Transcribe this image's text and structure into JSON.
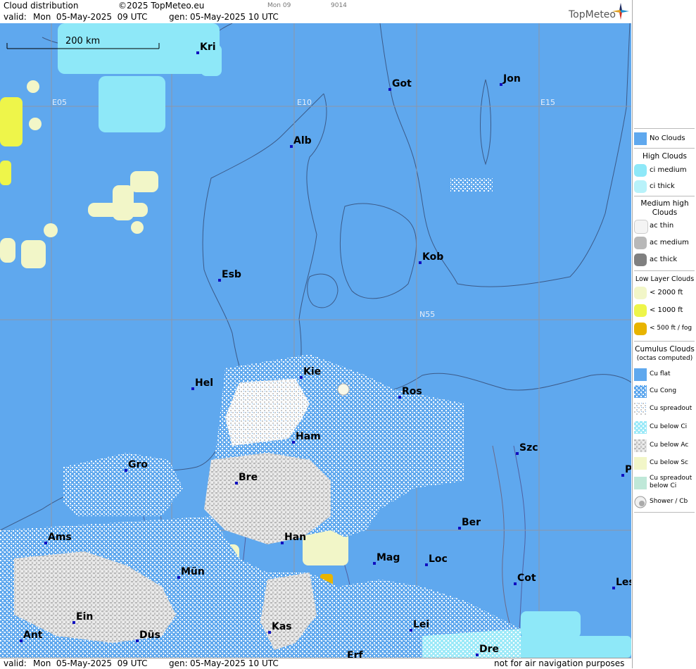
{
  "header": {
    "title": "Cloud distribution",
    "copyright": "©2025 TopMeteo.eu",
    "small_day": "Mon 09",
    "small_code": "9014",
    "valid_label": "valid:",
    "valid_value": "Mon  05-May-2025  09 UTC",
    "gen_label": "gen:",
    "gen_value": "05-May-2025 10 UTC",
    "brand": "TopMeteo"
  },
  "scale": {
    "label": "200 km"
  },
  "grid_labels": {
    "e05": "E05",
    "e10": "E10",
    "e15": "E15",
    "n55": "N55"
  },
  "cities": [
    {
      "name": "Kri"
    },
    {
      "name": "Got"
    },
    {
      "name": "Jon"
    },
    {
      "name": "Alb"
    },
    {
      "name": "Kob"
    },
    {
      "name": "Esb"
    },
    {
      "name": "Kie"
    },
    {
      "name": "Hel"
    },
    {
      "name": "Ros"
    },
    {
      "name": "Ham"
    },
    {
      "name": "Szc"
    },
    {
      "name": "Gro"
    },
    {
      "name": "Bre"
    },
    {
      "name": "P"
    },
    {
      "name": "Ber"
    },
    {
      "name": "Ams"
    },
    {
      "name": "Han"
    },
    {
      "name": "Mag"
    },
    {
      "name": "Loc"
    },
    {
      "name": "Mün"
    },
    {
      "name": "Cot"
    },
    {
      "name": "Les"
    },
    {
      "name": "Ein"
    },
    {
      "name": "Lei"
    },
    {
      "name": "Kas"
    },
    {
      "name": "Ant"
    },
    {
      "name": "Düs"
    },
    {
      "name": "Dre"
    },
    {
      "name": "Erf"
    }
  ],
  "footer": {
    "valid_label": "valid:",
    "valid_value": "Mon  05-May-2025  09 UTC",
    "gen_label": "gen:",
    "gen_value": "05-May-2025 10 UTC",
    "disclaimer": "not for air navigation purposes"
  },
  "legend": {
    "no_clouds": "No Clouds",
    "high_title": "High Clouds",
    "ci_medium": "ci medium",
    "ci_thick": "ci thick",
    "medium_title_1": "Medium high",
    "medium_title_2": "Clouds",
    "ac_thin": "ac thin",
    "ac_medium": "ac medium",
    "ac_thick": "ac thick",
    "low_title": "Low Layer Clouds",
    "lt2000": "< 2000 ft",
    "lt1000": "< 1000 ft",
    "lt500": "< 500 ft / fog",
    "cu_title": "Cumulus Clouds",
    "cu_sub": "(octas computed)",
    "cu_flat": "Cu flat",
    "cu_cong": "Cu Cong",
    "cu_spreadout": "Cu spreadout",
    "cu_below_ci": "Cu below Ci",
    "cu_below_ac": "Cu below Ac",
    "cu_below_sc": "Cu below Sc",
    "cu_spread_ci_1": "Cu spreadout",
    "cu_spread_ci_2": "below Ci",
    "shower": "Shower / Cb"
  },
  "colors": {
    "sea_no_clouds": "#5fa8ee",
    "ci_medium": "#8ee8f8",
    "ci_thick": "#b8f2fa",
    "low_2000": "#f2f6c8",
    "low_1000": "#eef54a",
    "fog": "#e8b400",
    "cu_white": "#ffffff",
    "cu_grey": "#c8c8c8"
  }
}
